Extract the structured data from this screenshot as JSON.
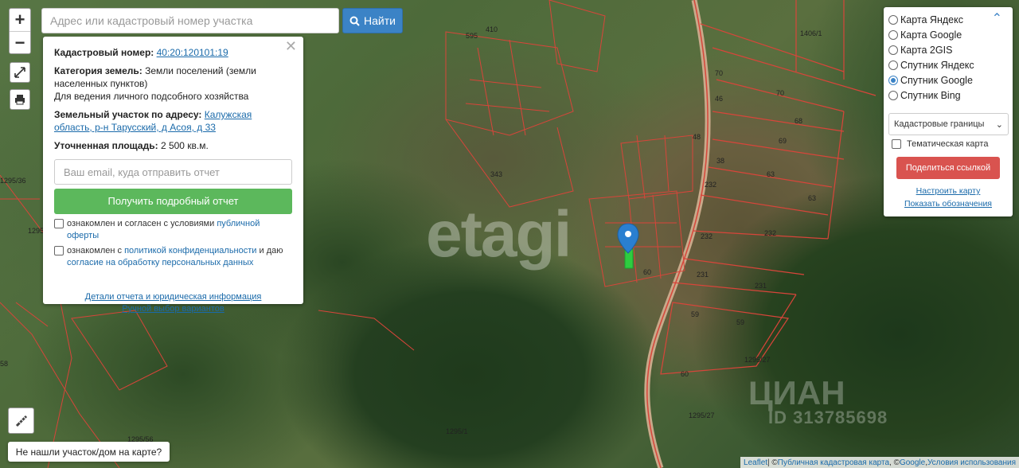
{
  "search": {
    "placeholder": "Адрес или кадастровый номер участка",
    "button_label": "Найти"
  },
  "zoom": {
    "in": "+",
    "out": "−"
  },
  "info_panel": {
    "cadastral_label": "Кадастровый номер:",
    "cadastral_value": "40:20:120101:19",
    "category_label": "Категория земель:",
    "category_value": "Земли поселений (земли населенных пунктов)",
    "usage": "Для ведения личного подсобного хозяйства",
    "address_label": "Земельный участок по адресу:",
    "address_value": "Калужская область, р-н Тарусский, д Асоя, д 33",
    "area_label": "Уточненная площадь:",
    "area_value": "2 500 кв.м.",
    "email_placeholder": "Ваш email, куда отправить отчет",
    "report_button": "Получить подробный отчет",
    "offer_prefix": "ознакомлен и согласен с условиями",
    "offer_link": "публичной оферты",
    "privacy_prefix": "ознакомлен с",
    "privacy_link": "политикой конфиденциальности",
    "privacy_mid": "и даю",
    "consent_link": "согласие на обработку персональных данных",
    "details_link": "Детали отчета и юридическая информация",
    "manual_link": "Ручной выбор вариантов"
  },
  "layers": {
    "options": [
      "Карта Яндекс",
      "Карта Google",
      "Карта 2GIS",
      "Спутник Яндекс",
      "Спутник Google",
      "Спутник Bing"
    ],
    "selected_index": 4,
    "overlay_select": "Кадастровые границы",
    "thematic_label": "Тематическая карта",
    "share_button": "Поделиться ссылкой",
    "setup_link": "Настроить карту",
    "legend_link": "Показать обозначения"
  },
  "map_labels": [
    "1406/1",
    "70",
    "70",
    "595",
    "410",
    "46",
    "68",
    "48",
    "69",
    "63",
    "63",
    "232",
    "232",
    "232",
    "231",
    "231",
    "343",
    "60",
    "59",
    "59",
    "60",
    "1295/36",
    "1295/36",
    "1295/27",
    "1295/27",
    "1295/1",
    "1295/56",
    "58",
    "38"
  ],
  "watermarks": {
    "etagi": "etagi",
    "cian": "ЦИАН",
    "cian_id": "ID 313785698"
  },
  "not_found_label": "Не нашли участок/дом на карте?",
  "attribution": {
    "leaflet": "Leaflet",
    "sep1": " | © ",
    "pkk": "Публичная кадастровая карта",
    "sep2": ", © ",
    "google": "Google",
    "sep3": ", ",
    "terms": "Условия использования"
  },
  "colors": {
    "accent_blue": "#3b83c6",
    "report_green": "#5cb85c",
    "share_red": "#d9534f",
    "parcel_red": "#d8453a"
  },
  "icons": {
    "search": "search-icon",
    "fullscreen": "fullscreen-icon",
    "print": "print-icon",
    "ruler": "ruler-icon",
    "marker": "map-marker-icon",
    "chevron": "chevron-up-icon",
    "close": "close-icon"
  }
}
